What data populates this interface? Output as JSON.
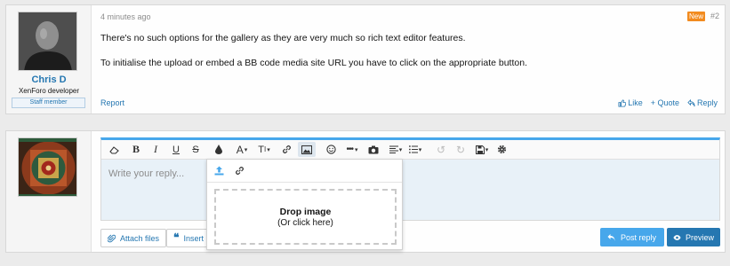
{
  "post": {
    "author_name": "Chris D",
    "author_title": "XenForo developer",
    "staff_badge": "Staff member",
    "time": "4 minutes ago",
    "new_badge": "New",
    "post_number": "#2",
    "paragraphs": [
      "There's no such options for the gallery as they are very much so rich text editor features.",
      "To initialise the upload or embed a BB code media site URL you have to click on the appropriate button."
    ],
    "report_label": "Report",
    "like_label": "Like",
    "quote_label": "+ Quote",
    "reply_label": "Reply"
  },
  "editor": {
    "placeholder": "Write your reply...",
    "toolbar": [
      "eraser-icon",
      "bold-icon",
      "italic-icon",
      "underline-icon",
      "strikethrough-icon",
      "color-icon",
      "font-size-icon",
      "font-family-icon",
      "link-icon",
      "image-icon",
      "smilie-icon",
      "more-icon",
      "media-icon",
      "align-icon",
      "list-icon",
      "undo-icon",
      "redo-icon",
      "drafts-icon",
      "settings-icon"
    ],
    "image_popup": {
      "tabs": [
        "upload-icon",
        "link-icon"
      ],
      "drop_title": "Drop image",
      "drop_sub": "(Or click here)"
    }
  },
  "reply_actions": {
    "attach_label": "Attach files",
    "insert_label": "Insert",
    "post_reply_label": "Post reply",
    "preview_label": "Preview"
  },
  "colors": {
    "link": "#2577b1",
    "accent": "#47a7eb",
    "new_badge": "#f28b1f"
  }
}
